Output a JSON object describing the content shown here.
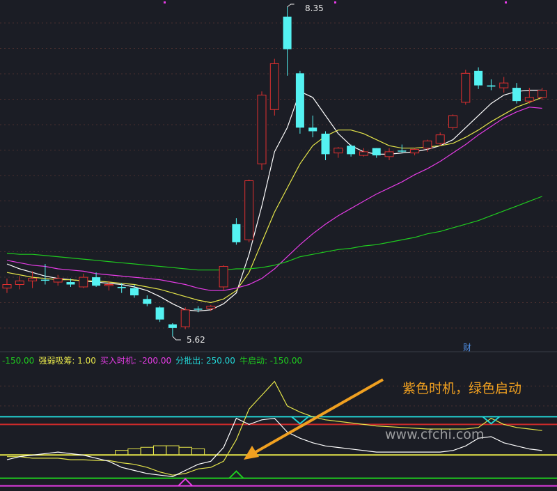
{
  "chart_data": [
    {
      "type": "candlestick",
      "panel": "main",
      "annotations": {
        "high_label": "8.35",
        "low_label": "5.62",
        "marker": "财"
      },
      "candles": [
        {
          "o": 6.05,
          "h": 6.1,
          "l": 5.98,
          "c": 6.02,
          "color": "red"
        },
        {
          "o": 6.05,
          "h": 6.12,
          "l": 6.01,
          "c": 6.08,
          "color": "red"
        },
        {
          "o": 6.08,
          "h": 6.16,
          "l": 6.02,
          "c": 6.1,
          "color": "red"
        },
        {
          "o": 6.09,
          "h": 6.22,
          "l": 6.05,
          "c": 6.09,
          "color": "cyan"
        },
        {
          "o": 6.07,
          "h": 6.13,
          "l": 6.04,
          "c": 6.1,
          "color": "red"
        },
        {
          "o": 6.07,
          "h": 6.1,
          "l": 6.03,
          "c": 6.05,
          "color": "cyan"
        },
        {
          "o": 6.03,
          "h": 6.14,
          "l": 6.02,
          "c": 6.11,
          "color": "red"
        },
        {
          "o": 6.11,
          "h": 6.15,
          "l": 6.03,
          "c": 6.04,
          "color": "cyan"
        },
        {
          "o": 6.04,
          "h": 6.08,
          "l": 6.0,
          "c": 6.05,
          "color": "red"
        },
        {
          "o": 6.03,
          "h": 6.06,
          "l": 5.98,
          "c": 6.02,
          "color": "cyan"
        },
        {
          "o": 6.02,
          "h": 6.05,
          "l": 5.94,
          "c": 5.96,
          "color": "cyan"
        },
        {
          "o": 5.93,
          "h": 5.96,
          "l": 5.87,
          "c": 5.89,
          "color": "cyan"
        },
        {
          "o": 5.86,
          "h": 5.87,
          "l": 5.74,
          "c": 5.76,
          "color": "cyan"
        },
        {
          "o": 5.72,
          "h": 5.73,
          "l": 5.62,
          "c": 5.69,
          "color": "cyan"
        },
        {
          "o": 5.7,
          "h": 5.86,
          "l": 5.68,
          "c": 5.84,
          "color": "red"
        },
        {
          "o": 5.85,
          "h": 5.87,
          "l": 5.82,
          "c": 5.85,
          "color": "cyan"
        },
        {
          "o": 5.85,
          "h": 5.88,
          "l": 5.83,
          "c": 5.87,
          "color": "red"
        },
        {
          "o": 6.03,
          "h": 6.21,
          "l": 6.0,
          "c": 6.2,
          "color": "red"
        },
        {
          "o": 6.4,
          "h": 6.6,
          "l": 6.38,
          "c": 6.55,
          "color": "cyan"
        },
        {
          "o": 6.42,
          "h": 6.92,
          "l": 6.4,
          "c": 6.91,
          "color": "red"
        },
        {
          "o": 7.05,
          "h": 7.65,
          "l": 7.0,
          "c": 7.62,
          "color": "red"
        },
        {
          "o": 7.5,
          "h": 7.92,
          "l": 7.45,
          "c": 7.88,
          "color": "red"
        },
        {
          "o": 8.0,
          "h": 8.35,
          "l": 7.78,
          "c": 8.27,
          "color": "cyan"
        },
        {
          "o": 7.8,
          "h": 7.82,
          "l": 7.3,
          "c": 7.35,
          "color": "cyan"
        },
        {
          "o": 7.35,
          "h": 7.45,
          "l": 7.27,
          "c": 7.32,
          "color": "cyan"
        },
        {
          "o": 7.3,
          "h": 7.32,
          "l": 7.08,
          "c": 7.13,
          "color": "cyan"
        },
        {
          "o": 7.14,
          "h": 7.19,
          "l": 7.1,
          "c": 7.18,
          "color": "red"
        },
        {
          "o": 7.2,
          "h": 7.21,
          "l": 7.11,
          "c": 7.13,
          "color": "cyan"
        },
        {
          "o": 7.15,
          "h": 7.18,
          "l": 7.11,
          "c": 7.12,
          "color": "red"
        },
        {
          "o": 7.18,
          "h": 7.18,
          "l": 7.1,
          "c": 7.12,
          "color": "cyan"
        },
        {
          "o": 7.11,
          "h": 7.18,
          "l": 7.08,
          "c": 7.15,
          "color": "red"
        },
        {
          "o": 7.16,
          "h": 7.21,
          "l": 7.14,
          "c": 7.16,
          "color": "cyan"
        },
        {
          "o": 7.14,
          "h": 7.18,
          "l": 7.12,
          "c": 7.17,
          "color": "red"
        },
        {
          "o": 7.18,
          "h": 7.25,
          "l": 7.15,
          "c": 7.24,
          "color": "red"
        },
        {
          "o": 7.22,
          "h": 7.31,
          "l": 7.2,
          "c": 7.29,
          "color": "red"
        },
        {
          "o": 7.35,
          "h": 7.46,
          "l": 7.33,
          "c": 7.45,
          "color": "red"
        },
        {
          "o": 7.56,
          "h": 7.83,
          "l": 7.54,
          "c": 7.8,
          "color": "red"
        },
        {
          "o": 7.82,
          "h": 7.85,
          "l": 7.67,
          "c": 7.7,
          "color": "cyan"
        },
        {
          "o": 7.7,
          "h": 7.75,
          "l": 7.66,
          "c": 7.69,
          "color": "cyan"
        },
        {
          "o": 7.68,
          "h": 7.77,
          "l": 7.64,
          "c": 7.72,
          "color": "red"
        },
        {
          "o": 7.68,
          "h": 7.72,
          "l": 7.55,
          "c": 7.57,
          "color": "cyan"
        },
        {
          "o": 7.57,
          "h": 7.68,
          "l": 7.55,
          "c": 7.6,
          "color": "red"
        },
        {
          "o": 7.6,
          "h": 7.68,
          "l": 7.58,
          "c": 7.66,
          "color": "red"
        }
      ],
      "series": [
        {
          "color": "#ffffff",
          "values": [
            6.22,
            6.18,
            6.15,
            6.12,
            6.1,
            6.09,
            6.08,
            6.07,
            6.06,
            6.05,
            6.03,
            6.0,
            5.95,
            5.89,
            5.84,
            5.83,
            5.84,
            5.89,
            5.98,
            6.3,
            6.7,
            7.15,
            7.35,
            7.65,
            7.6,
            7.45,
            7.3,
            7.2,
            7.15,
            7.13,
            7.13,
            7.14,
            7.15,
            7.17,
            7.2,
            7.25,
            7.35,
            7.45,
            7.55,
            7.62,
            7.65,
            7.66,
            7.66
          ]
        },
        {
          "color": "#e6e64a",
          "values": [
            6.15,
            6.13,
            6.11,
            6.1,
            6.09,
            6.09,
            6.08,
            6.08,
            6.07,
            6.06,
            6.05,
            6.03,
            6.01,
            5.98,
            5.95,
            5.92,
            5.9,
            5.93,
            6.0,
            6.15,
            6.4,
            6.65,
            6.85,
            7.05,
            7.2,
            7.28,
            7.33,
            7.33,
            7.3,
            7.25,
            7.2,
            7.18,
            7.18,
            7.19,
            7.2,
            7.22,
            7.27,
            7.33,
            7.4,
            7.46,
            7.52,
            7.56,
            7.6
          ]
        },
        {
          "color": "#e63ce6",
          "values": [
            6.25,
            6.23,
            6.21,
            6.2,
            6.18,
            6.17,
            6.16,
            6.14,
            6.13,
            6.12,
            6.11,
            6.1,
            6.09,
            6.07,
            6.05,
            6.02,
            6.0,
            6.0,
            6.02,
            6.05,
            6.1,
            6.18,
            6.28,
            6.38,
            6.47,
            6.55,
            6.62,
            6.68,
            6.74,
            6.8,
            6.85,
            6.9,
            6.96,
            7.01,
            7.07,
            7.14,
            7.21,
            7.29,
            7.36,
            7.43,
            7.48,
            7.52,
            7.51
          ]
        },
        {
          "color": "#1fcc1f",
          "values": [
            6.31,
            6.3,
            6.3,
            6.29,
            6.28,
            6.27,
            6.26,
            6.25,
            6.24,
            6.23,
            6.22,
            6.21,
            6.2,
            6.19,
            6.18,
            6.17,
            6.17,
            6.17,
            6.18,
            6.18,
            6.19,
            6.21,
            6.24,
            6.28,
            6.3,
            6.32,
            6.34,
            6.35,
            6.37,
            6.38,
            6.4,
            6.42,
            6.44,
            6.47,
            6.49,
            6.52,
            6.55,
            6.58,
            6.62,
            6.66,
            6.7,
            6.74,
            6.78
          ]
        }
      ]
    },
    {
      "type": "line",
      "panel": "indicator",
      "legend": [
        {
          "text": "-150.00",
          "color": "#1fcc1f"
        },
        {
          "text": "强弱吸筹: 1.00",
          "color": "#e6e64a"
        },
        {
          "text": "买入时机: -200.00",
          "color": "#e63ce6"
        },
        {
          "text": "分批出: 250.00",
          "color": "#22d6d6"
        },
        {
          "text": "牛启动: -150.00",
          "color": "#1fcc1f"
        }
      ],
      "annotation": "紫色时机，绿色启动",
      "watermark": "www.cfchi.com",
      "ref_lines": [
        {
          "value": 250,
          "color": "#22d6d6"
        },
        {
          "value": 200,
          "color": "#cc2a2a"
        },
        {
          "value": 1,
          "color": "#e6e64a"
        },
        {
          "value": -150,
          "color": "#1fcc1f"
        },
        {
          "value": -200,
          "color": "#e63ce6"
        }
      ],
      "ylim": [
        -220,
        560
      ],
      "series": [
        {
          "color": "#e6e64a",
          "values": [
            -10,
            -10,
            -20,
            -20,
            -20,
            -30,
            -30,
            -35,
            -35,
            -50,
            -60,
            -80,
            -110,
            -130,
            -120,
            -90,
            -80,
            -40,
            100,
            300,
            390,
            480,
            320,
            280,
            250,
            230,
            220,
            210,
            200,
            190,
            185,
            180,
            175,
            170,
            170,
            170,
            170,
            180,
            240,
            200,
            180,
            170,
            160
          ]
        },
        {
          "color": "#ffffff",
          "values": [
            -30,
            -10,
            0,
            10,
            20,
            10,
            0,
            -20,
            -40,
            -80,
            -100,
            -120,
            -130,
            -140,
            -100,
            -60,
            -40,
            50,
            240,
            200,
            230,
            240,
            150,
            110,
            80,
            60,
            50,
            40,
            30,
            20,
            20,
            20,
            20,
            20,
            20,
            30,
            60,
            110,
            120,
            80,
            60,
            40,
            30
          ]
        },
        {
          "color": "#e6e64a",
          "values": [
            1,
            1,
            1,
            1,
            1,
            1,
            1,
            1,
            1,
            1,
            1,
            1,
            1,
            1,
            1,
            1,
            1,
            1,
            1,
            1,
            1,
            1,
            1,
            1,
            1,
            1,
            1,
            1,
            1,
            1,
            1,
            1,
            1,
            1,
            1,
            1,
            1,
            1,
            1,
            1,
            1,
            1,
            1
          ],
          "step": [
            0,
            0,
            0,
            0,
            0,
            0,
            0,
            0,
            0,
            30,
            40,
            50,
            60,
            60,
            50,
            40,
            0,
            0,
            0,
            0,
            0,
            0,
            0,
            0,
            0,
            0,
            0,
            0,
            0,
            0,
            0,
            0,
            0,
            0,
            0,
            0,
            0,
            0,
            0,
            0,
            0,
            0,
            0
          ]
        }
      ]
    }
  ]
}
